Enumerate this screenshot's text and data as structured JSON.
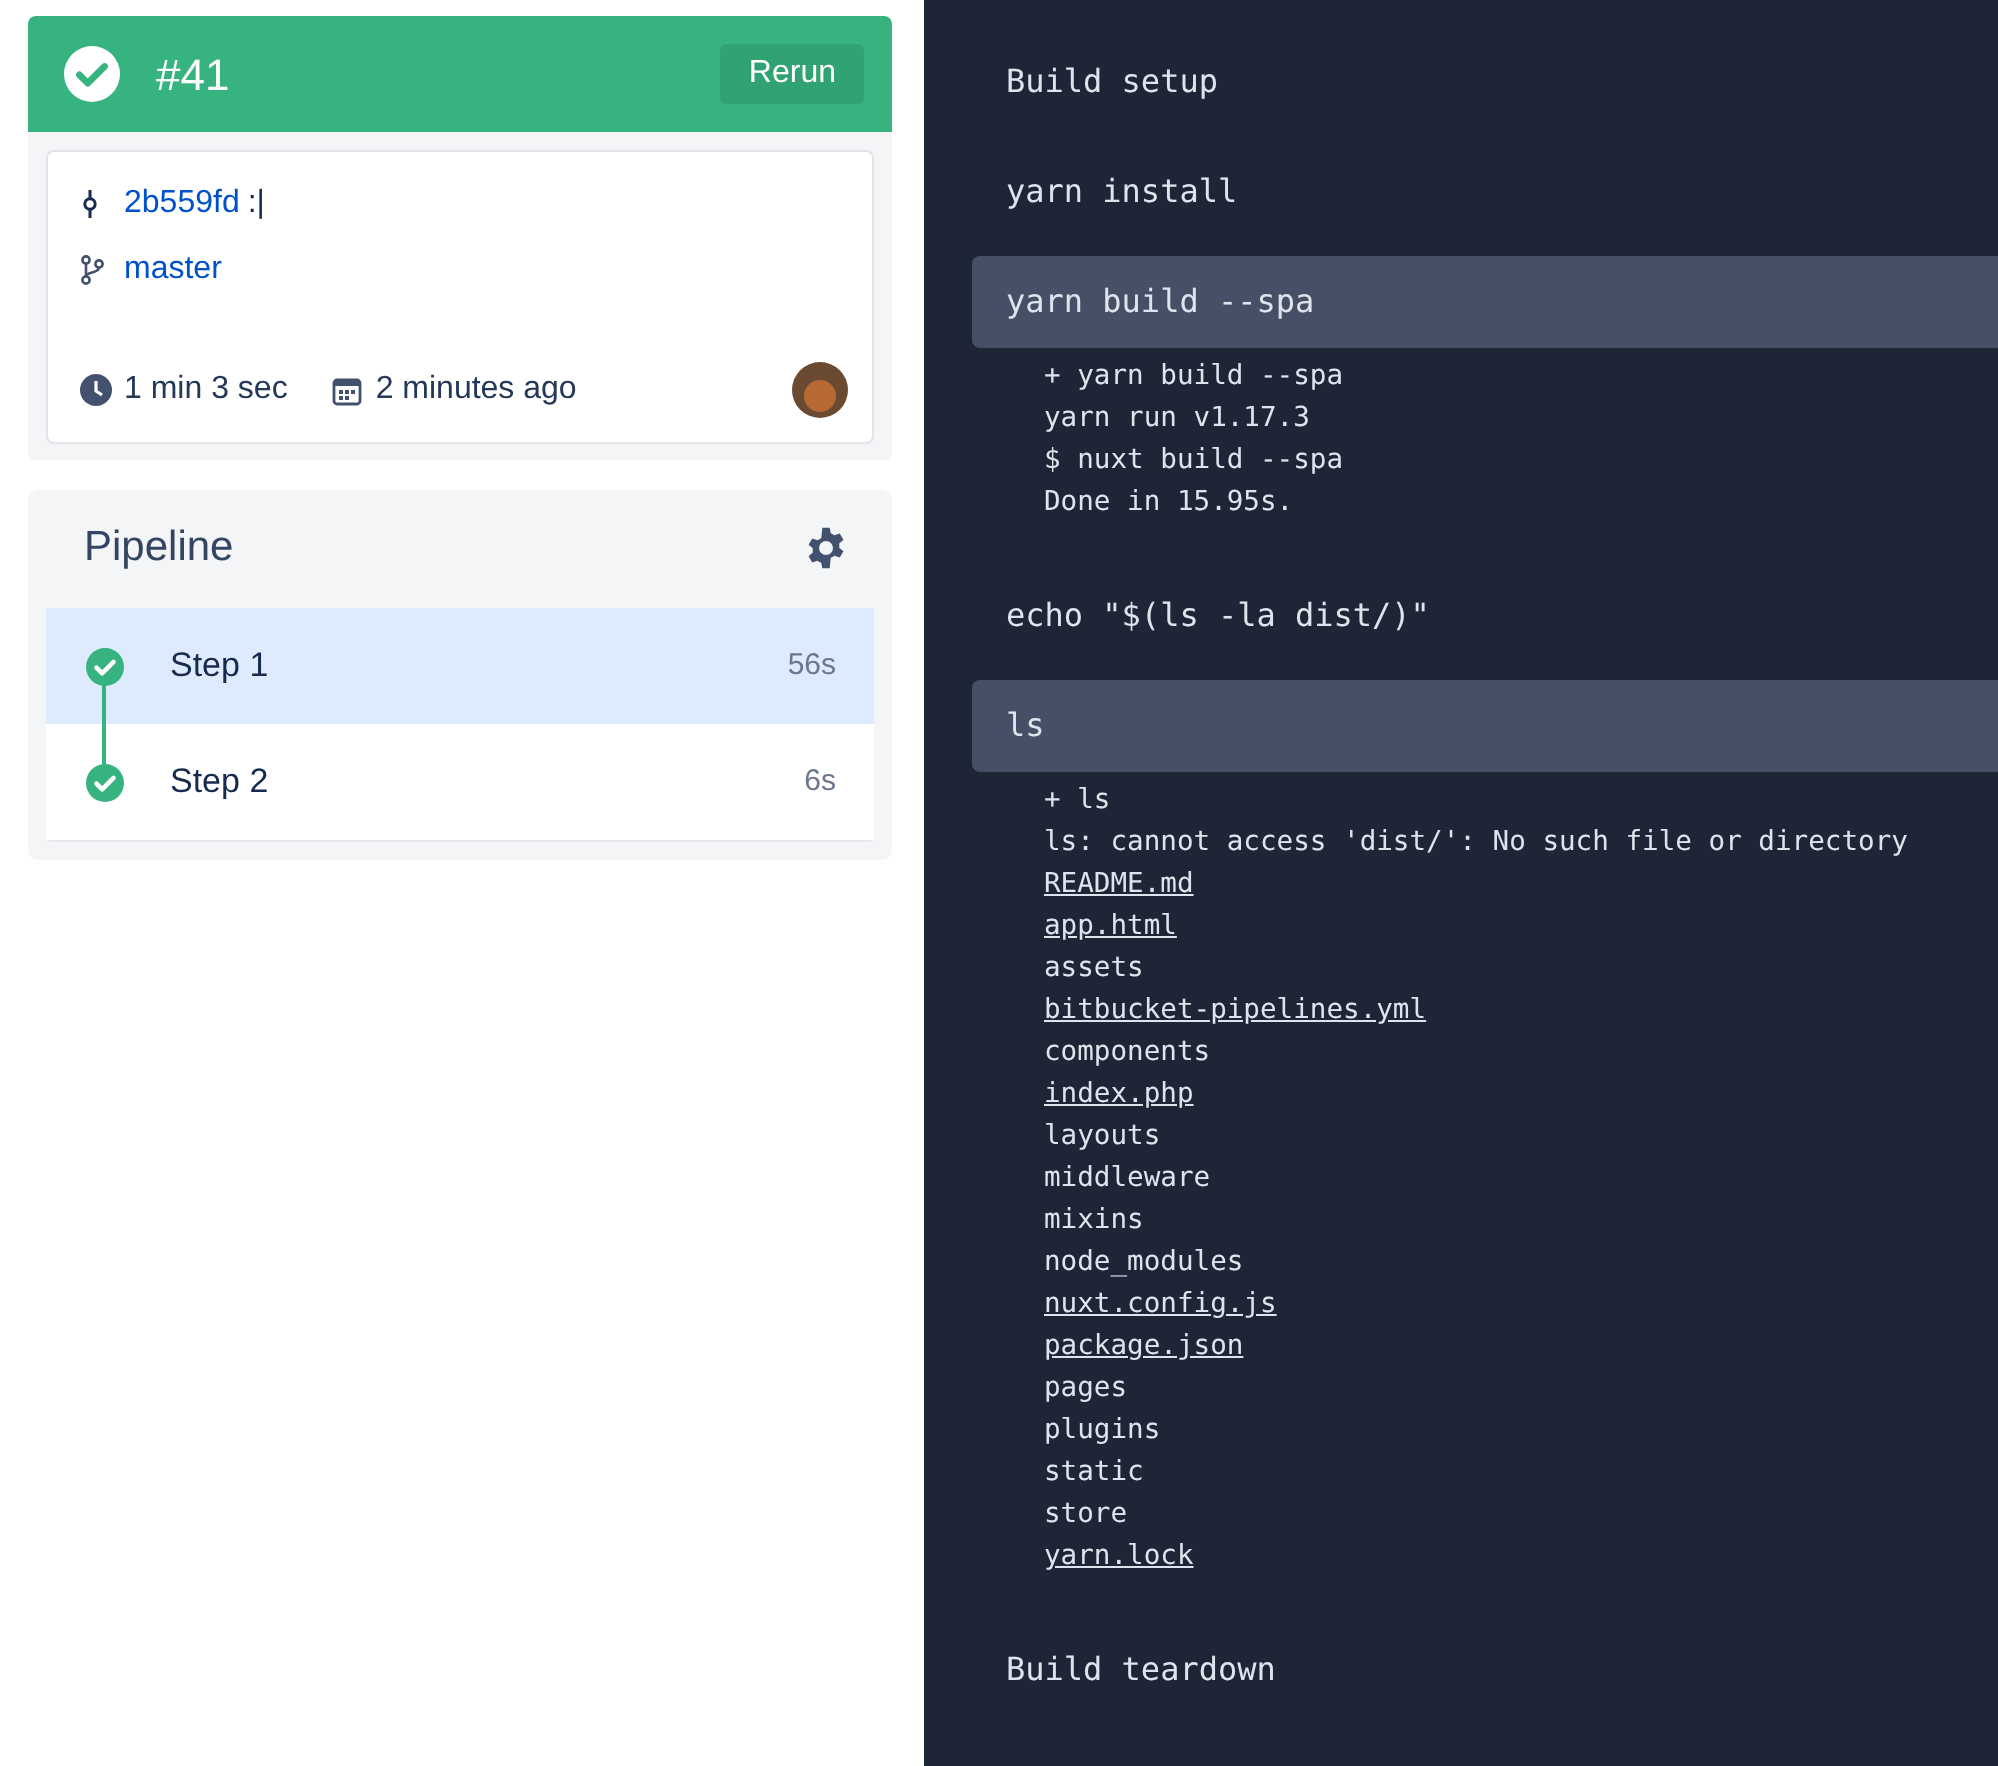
{
  "build": {
    "passed": true,
    "number": "#41",
    "rerun_label": "Rerun"
  },
  "commit": {
    "hash": "2b559fd",
    "message": ":|",
    "branch": "master",
    "duration": "1 min 3 sec",
    "time_ago": "2 minutes ago"
  },
  "pipeline": {
    "title": "Pipeline",
    "steps": [
      {
        "name": "Step 1",
        "duration": "56s",
        "passed": true,
        "selected": true
      },
      {
        "name": "Step 2",
        "duration": "6s",
        "passed": true,
        "selected": false
      }
    ]
  },
  "log": {
    "commands": [
      {
        "text": "Build setup",
        "expanded": false
      },
      {
        "text": "yarn install",
        "expanded": false
      },
      {
        "text": "yarn build --spa",
        "expanded": true,
        "output": [
          {
            "text": "+ yarn build --spa",
            "underlined": false
          },
          {
            "text": "yarn run v1.17.3",
            "underlined": false
          },
          {
            "text": "$ nuxt build --spa",
            "underlined": false
          },
          {
            "text": "Done in 15.95s.",
            "underlined": false
          }
        ]
      },
      {
        "text": "echo \"$(ls -la dist/)\"",
        "expanded": false
      },
      {
        "text": "ls",
        "expanded": true,
        "output": [
          {
            "text": "+ ls",
            "underlined": false
          },
          {
            "text": "ls: cannot access 'dist/': No such file or directory",
            "underlined": false
          },
          {
            "text": "README.md",
            "underlined": true
          },
          {
            "text": "app.html",
            "underlined": true
          },
          {
            "text": "assets",
            "underlined": false
          },
          {
            "text": "bitbucket-pipelines.yml",
            "underlined": true
          },
          {
            "text": "components",
            "underlined": false
          },
          {
            "text": "index.php",
            "underlined": true
          },
          {
            "text": "layouts",
            "underlined": false
          },
          {
            "text": "middleware",
            "underlined": false
          },
          {
            "text": "mixins",
            "underlined": false
          },
          {
            "text": "node_modules",
            "underlined": false
          },
          {
            "text": "nuxt.config.js",
            "underlined": true
          },
          {
            "text": "package.json",
            "underlined": true
          },
          {
            "text": "pages",
            "underlined": false
          },
          {
            "text": "plugins",
            "underlined": false
          },
          {
            "text": "static",
            "underlined": false
          },
          {
            "text": "store",
            "underlined": false
          },
          {
            "text": "yarn.lock",
            "underlined": true
          }
        ]
      },
      {
        "text": "Build teardown",
        "expanded": false
      }
    ]
  }
}
